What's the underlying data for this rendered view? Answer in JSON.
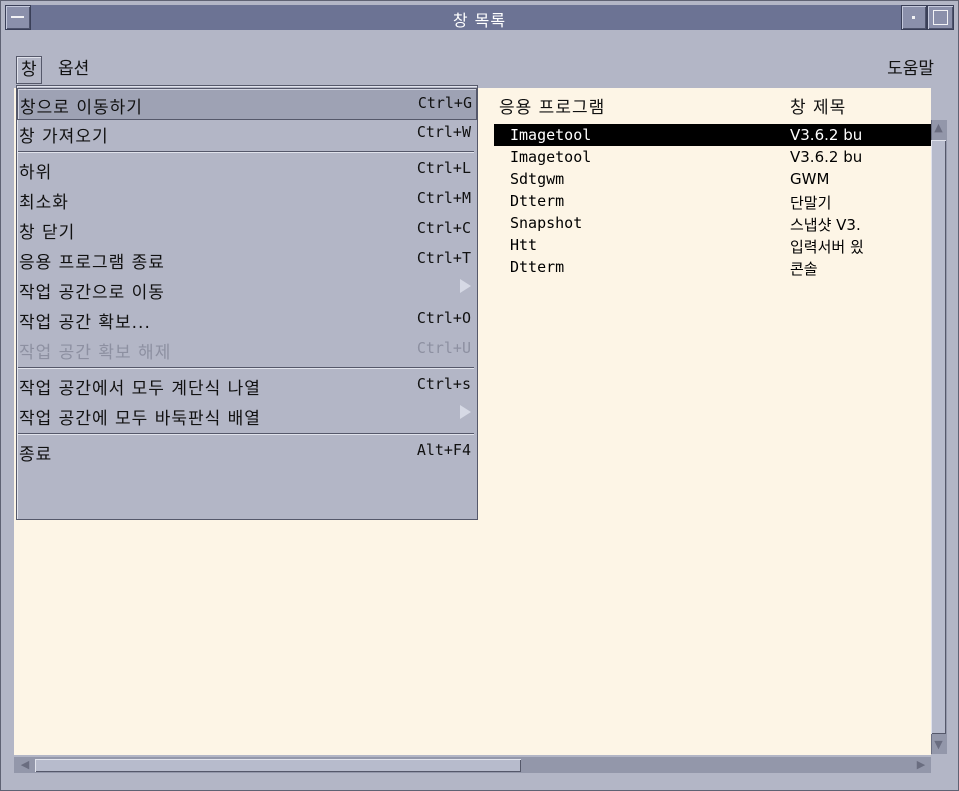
{
  "window": {
    "title": "창 목록"
  },
  "menubar": {
    "window": "창",
    "options": "옵션",
    "help": "도움말"
  },
  "columns": {
    "app": "응용 프로그램",
    "title": "창 제목"
  },
  "rows": [
    {
      "app": "Imagetool",
      "title": "V3.6.2 bu",
      "selected": true
    },
    {
      "app": "Imagetool",
      "title": "V3.6.2 bu"
    },
    {
      "app": "Sdtgwm",
      "title": "GWM"
    },
    {
      "app": "Dtterm",
      "title": "단말기"
    },
    {
      "app": "Snapshot",
      "title": "스냅샷 V3."
    },
    {
      "app": "Htt",
      "title": "입력서버 읬"
    },
    {
      "app": "Dtterm",
      "title": "콘솔"
    }
  ],
  "menu": {
    "items": [
      {
        "label": "창으로 이동하기",
        "accel": "Ctrl+G",
        "highlighted": true
      },
      {
        "label": "창 가져오기",
        "accel": "Ctrl+W"
      },
      {
        "label": "하위",
        "accel": "Ctrl+L"
      },
      {
        "label": "최소화",
        "accel": "Ctrl+M"
      },
      {
        "label": "창 닫기",
        "accel": "Ctrl+C"
      },
      {
        "label": "응용 프로그램 종료",
        "accel": "Ctrl+T"
      },
      {
        "label": "작업 공간으로 이동",
        "accel": "",
        "submenu": true
      },
      {
        "label": "작업 공간 확보...",
        "accel": "Ctrl+O"
      },
      {
        "label": "작업 공간 확보 해제",
        "accel": "Ctrl+U",
        "disabled": true
      },
      {
        "label": "작업 공간에서 모두 계단식 나열",
        "accel": "Ctrl+s"
      },
      {
        "label": "작업 공간에 모두 바둑판식 배열",
        "accel": "",
        "submenu": true
      },
      {
        "label": "종료",
        "accel": "Alt+F4"
      }
    ]
  },
  "colors": {
    "selection": "#000000",
    "list_bg": "#fdf5e6",
    "chrome": "#b3b6c6",
    "titlebar": "#6c7394"
  }
}
